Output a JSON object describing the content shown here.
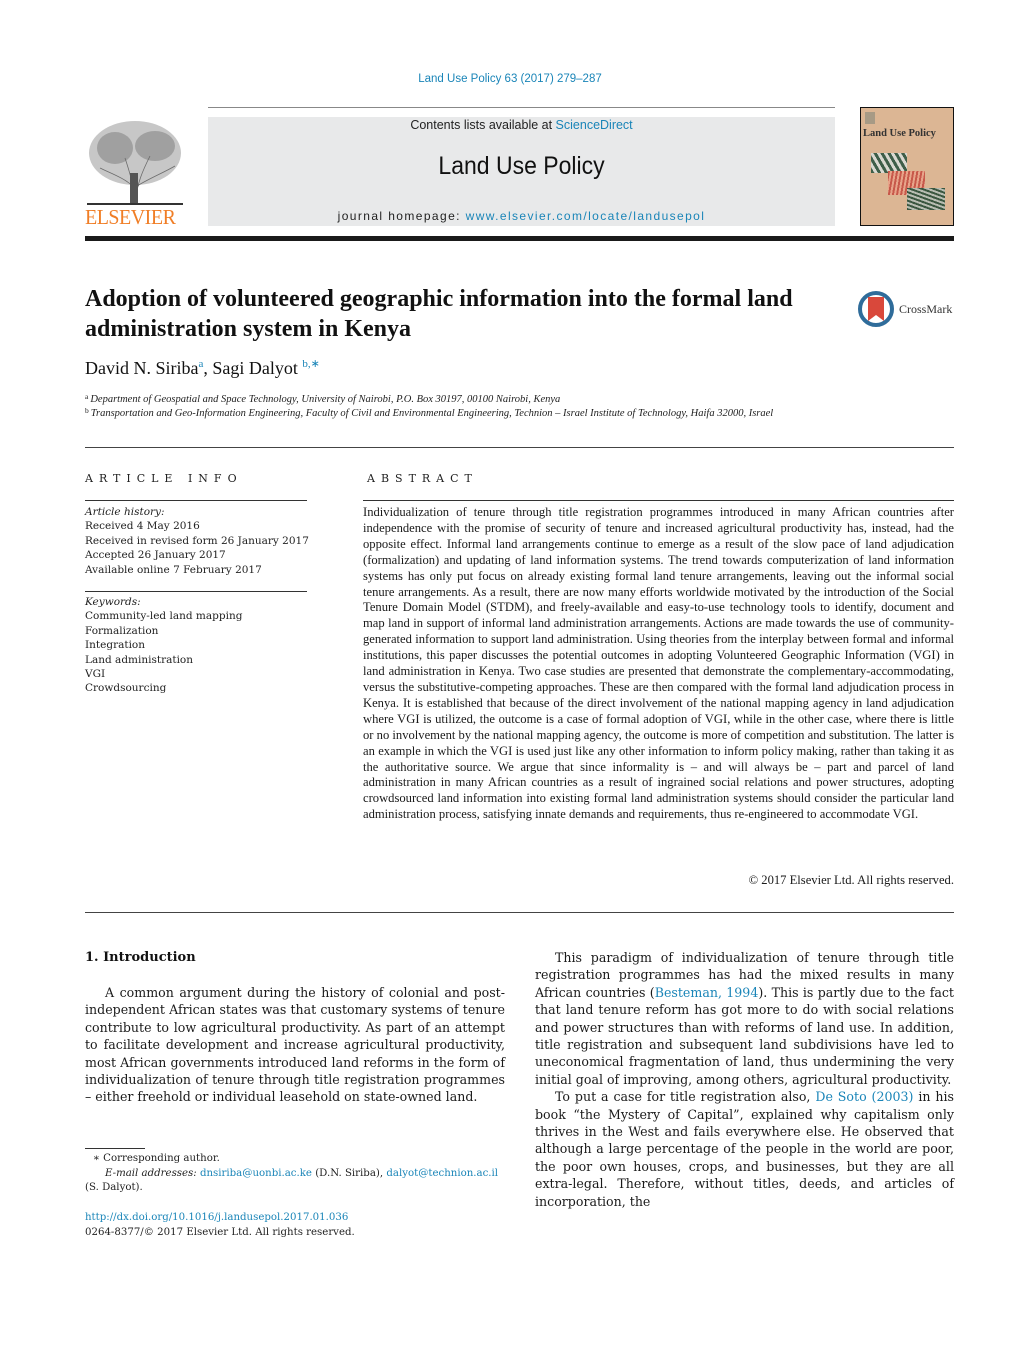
{
  "header": {
    "citation": "Land Use Policy 63 (2017) 279–287",
    "contents_prefix": "Contents lists available at ",
    "contents_link": "ScienceDirect",
    "journal_title": "Land Use Policy",
    "homepage_prefix": "journal homepage: ",
    "homepage_link": "www.elsevier.com/locate/landusepol",
    "publisher_logo_text": "ELSEVIER",
    "cover_title": "Land Use Policy",
    "crossmark_label": "CrossMark",
    "colors": {
      "link": "#1a85b8",
      "elsevier_orange": "#f07e26",
      "banner_bg": "#e8e9ea"
    }
  },
  "article": {
    "title": "Adoption of volunteered geographic information into the formal land administration system in Kenya",
    "authors": [
      {
        "name": "David N. Siriba",
        "sup": "a"
      },
      {
        "name": "Sagi Dalyot",
        "sup": "b,∗"
      }
    ],
    "author_separator": ", ",
    "affiliations": [
      {
        "sup": "a",
        "text": "Department of Geospatial and Space Technology, University of Nairobi, P.O. Box 30197, 00100 Nairobi, Kenya"
      },
      {
        "sup": "b",
        "text": "Transportation and Geo-Information Engineering, Faculty of Civil and Environmental Engineering, Technion – Israel Institute of Technology, Haifa 32000, Israel"
      }
    ]
  },
  "article_info": {
    "heading": "ARTICLE INFO",
    "history_label": "Article history:",
    "history": [
      "Received 4 May 2016",
      "Received in revised form 26 January 2017",
      "Accepted 26 January 2017",
      "Available online 7 February 2017"
    ],
    "keywords_label": "Keywords:",
    "keywords": [
      "Community-led land mapping",
      "Formalization",
      "Integration",
      "Land administration",
      "VGI",
      "Crowdsourcing"
    ]
  },
  "abstract": {
    "heading": "ABSTRACT",
    "text": "Individualization of tenure through title registration programmes introduced in many African countries after independence with the promise of security of tenure and increased agricultural productivity has, instead, had the opposite effect. Informal land arrangements continue to emerge as a result of the slow pace of land adjudication (formalization) and updating of land information systems. The trend towards computerization of land information systems has only put focus on already existing formal land tenure arrangements, leaving out the informal social tenure arrangements. As a result, there are now many efforts worldwide motivated by the introduction of the Social Tenure Domain Model (STDM), and freely-available and easy-to-use technology tools to identify, document and map land in support of informal land administration arrangements. Actions are made towards the use of community-generated information to support land administration. Using theories from the interplay between formal and informal institutions, this paper discusses the potential outcomes in adopting Volunteered Geographic Information (VGI) in land administration in Kenya. Two case studies are presented that demonstrate the complementary-accommodating, versus the substitutive-competing approaches. These are then compared with the formal land adjudication process in Kenya. It is established that because of the direct involvement of the national mapping agency in land adjudication where VGI is utilized, the outcome is a case of formal adoption of VGI, while in the other case, where there is little or no involvement by the national mapping agency, the outcome is more of competition and substitution. The latter is an example in which the VGI is used just like any other information to inform policy making, rather than taking it as the authoritative source. We argue that since informality is – and will always be – part and parcel of land administration in many African countries as a result of ingrained social relations and power structures, adopting crowdsourced land information into existing formal land administration systems should consider the particular land administration process, satisfying innate demands and requirements, thus re-engineered to accommodate VGI.",
    "copyright": "© 2017 Elsevier Ltd. All rights reserved."
  },
  "body": {
    "section_heading": "1.  Introduction",
    "left_paragraph": "A common argument during the history of colonial and post-independent African states was that customary systems of tenure contribute to low agricultural productivity. As part of an attempt to facilitate development and increase agricultural productivity, most African governments introduced land reforms in the form of individualization of tenure through title registration programmes – either freehold or individual leasehold on state-owned land.",
    "right_p1_before": "This paradigm of individualization of tenure through title registration programmes has had the mixed results in many African countries (",
    "right_p1_link": "Besteman, 1994",
    "right_p1_after": "). This is partly due to the fact that land tenure reform has got more to do with social relations and power structures than with reforms of land use. In addition, title registration and subsequent land subdivisions have led to uneconomical fragmentation of land, thus undermining the very initial goal of improving, among others, agricultural productivity.",
    "right_p2_before": "To put a case for title registration also, ",
    "right_p2_link": "De Soto (2003)",
    "right_p2_after": " in his book “the Mystery of Capital”, explained why capitalism only thrives in the West and fails everywhere else. He observed that although a large percentage of the people in the world are poor, the poor own houses, crops, and businesses, but they are all extra-legal. Therefore, without titles, deeds, and articles of incorporation, the"
  },
  "footnotes": {
    "corresponding": "∗  Corresponding author.",
    "email_label": "E-mail addresses:",
    "email1": "dnsiriba@uonbi.ac.ke",
    "email1_owner": " (D.N. Siriba), ",
    "email2": "dalyot@technion.ac.il",
    "email2_owner": "(S. Dalyot).",
    "doi": "http://dx.doi.org/10.1016/j.landusepol.2017.01.036",
    "issn_copyright": "0264-8377/© 2017 Elsevier Ltd. All rights reserved."
  }
}
